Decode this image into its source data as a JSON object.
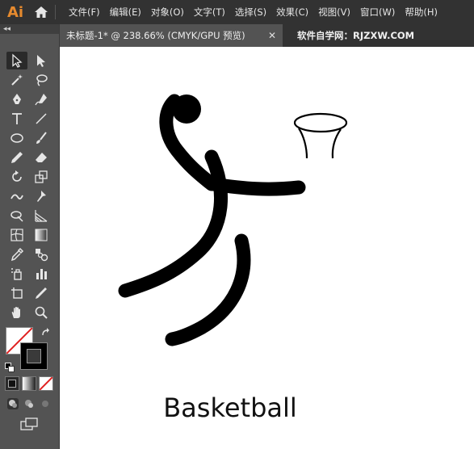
{
  "app": {
    "logo_text": "Ai"
  },
  "menu": [
    "文件(F)",
    "编辑(E)",
    "对象(O)",
    "文字(T)",
    "选择(S)",
    "效果(C)",
    "视图(V)",
    "窗口(W)",
    "帮助(H)"
  ],
  "document_tab": {
    "title": "未标题-1* @ 238.66% (CMYK/GPU 预览)",
    "close_symbol": "✕"
  },
  "watermark": "软件自学网：RJZXW.COM",
  "toolbar": {
    "collapse_glyph": "◂◂",
    "tools": [
      "selection-tool",
      "direct-selection-tool",
      "magic-wand-tool",
      "lasso-tool",
      "pen-tool",
      "curvature-tool",
      "type-tool",
      "line-tool",
      "ellipse-tool",
      "paintbrush-tool",
      "pencil-tool",
      "eraser-tool",
      "rotate-tool",
      "scale-tool",
      "warp-tool",
      "puppet-warp-tool",
      "shape-builder-tool",
      "perspective-grid-tool",
      "mesh-tool",
      "gradient-tool",
      "eyedropper-tool",
      "blend-tool",
      "symbol-sprayer-tool",
      "column-graph-tool",
      "artboard-tool",
      "slice-tool",
      "hand-tool",
      "zoom-tool"
    ],
    "colors": {
      "fill": "#ffffff",
      "stroke": "#000000",
      "none_slash": "#e02020"
    }
  },
  "canvas": {
    "caption": "Basketball"
  }
}
